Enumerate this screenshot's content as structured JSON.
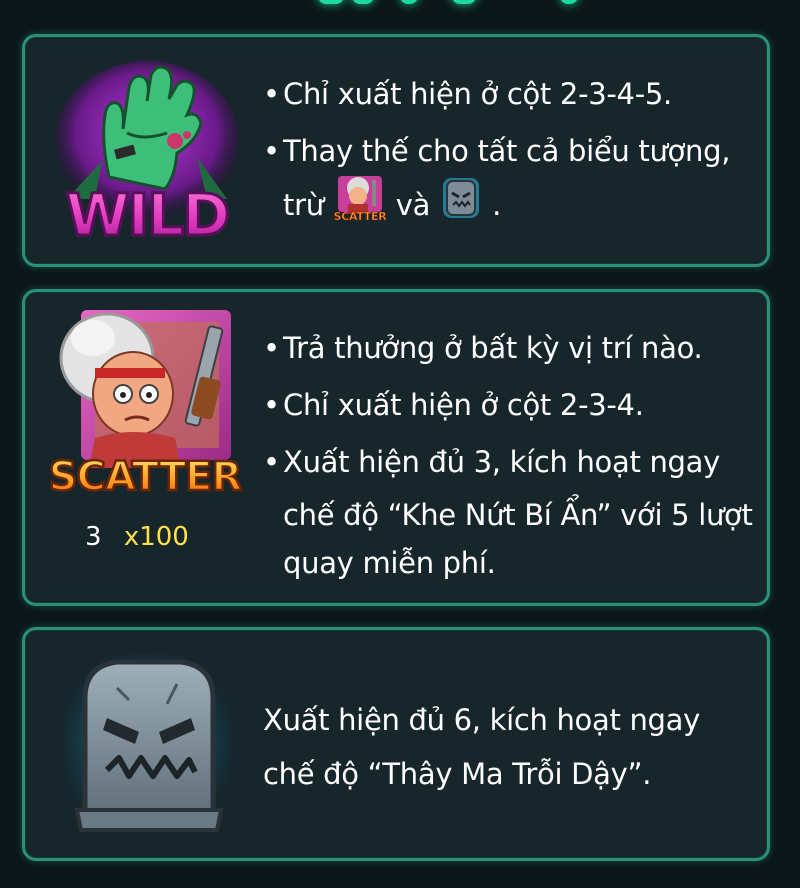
{
  "wild": {
    "symbol_icon": "zombie-hand-wild-icon",
    "symbol_word": "WILD",
    "bullets": [
      "Chỉ xuất hiện ở cột 2-3-4-5.",
      "Thay thế cho tất cả biểu tượng,"
    ],
    "continuation_prefix": "trừ",
    "continuation_mid": "và",
    "continuation_end": ".",
    "inline_icon_1": "scatter-granny-icon",
    "inline_icon_1_label": "SCATTER",
    "inline_icon_2": "tombstone-icon"
  },
  "scatter": {
    "symbol_icon": "granny-with-shotgun-icon",
    "symbol_word": "SCATTER",
    "payout_count": "3",
    "payout_multiplier": "x100",
    "bullets": [
      "Trả thưởng ở bất kỳ vị trí nào.",
      "Chỉ xuất hiện ở cột 2-3-4.",
      "Xuất hiện đủ 3, kích hoạt ngay"
    ],
    "continuation_lines": [
      "chế độ “Khe Nứt Bí Ẩn” với 5 lượt",
      "quay miễn phí."
    ]
  },
  "tomb": {
    "symbol_icon": "tombstone-icon",
    "lines": [
      "Xuất hiện đủ 6, kích hoạt ngay",
      "chế độ “Thây Ma Trỗi Dậy”."
    ]
  },
  "colors": {
    "background": "#0b1618",
    "panel": "#17262b",
    "panel_border": "#2c8f7a",
    "multiplier": "#ffe14a",
    "text": "#ffffff"
  }
}
